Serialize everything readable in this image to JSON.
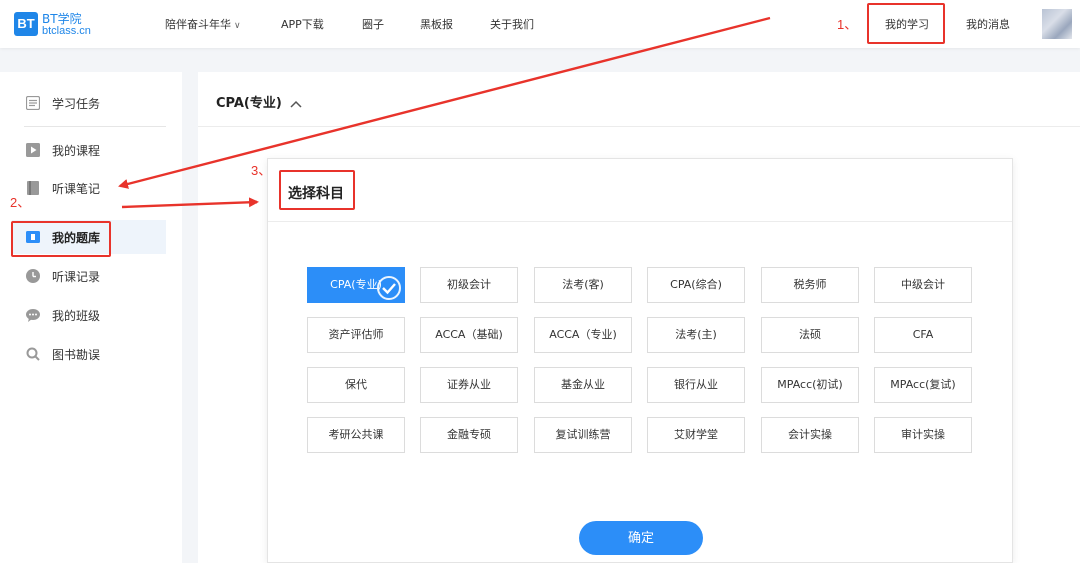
{
  "header": {
    "logo_top": "BT学院",
    "logo_bottom": "btclass.cn",
    "logo_mark": "BT",
    "nav": [
      {
        "label": "陪伴奋斗年华"
      },
      {
        "label": "APP下载"
      },
      {
        "label": "圈子"
      },
      {
        "label": "黑板报"
      },
      {
        "label": "关于我们"
      }
    ],
    "my_study": "我的学习",
    "my_messages": "我的消息"
  },
  "annotations": {
    "n1": "1、",
    "n2": "2、",
    "n3": "3、",
    "color": "#e8332b"
  },
  "sidebar": {
    "items": [
      {
        "label": "学习任务",
        "icon": "list-icon"
      },
      {
        "label": "我的课程",
        "icon": "play-icon"
      },
      {
        "label": "听课笔记",
        "icon": "notebook-icon"
      },
      {
        "label": "我的题库",
        "icon": "question-bank-icon"
      },
      {
        "label": "听课记录",
        "icon": "clock-icon"
      },
      {
        "label": "我的班级",
        "icon": "chat-icon"
      },
      {
        "label": "图书勘误",
        "icon": "search-icon"
      }
    ]
  },
  "main": {
    "title": "CPA(专业)"
  },
  "card": {
    "title": "选择科目",
    "subjects": [
      [
        "CPA(专业)",
        "初级会计",
        "法考(客)",
        "CPA(综合)",
        "税务师",
        "中级会计"
      ],
      [
        "资产评估师",
        "ACCA（基础)",
        "ACCA（专业)",
        "法考(主)",
        "法硕",
        "CFA"
      ],
      [
        "保代",
        "证券从业",
        "基金从业",
        "银行从业",
        "MPAcc(初试)",
        "MPAcc(复试)"
      ],
      [
        "考研公共课",
        "金融专硕",
        "复试训练营",
        "艾财学堂",
        "会计实操",
        "审计实操"
      ]
    ],
    "selected": "CPA(专业)",
    "confirm": "确定",
    "accent": "#2c8ef8"
  }
}
